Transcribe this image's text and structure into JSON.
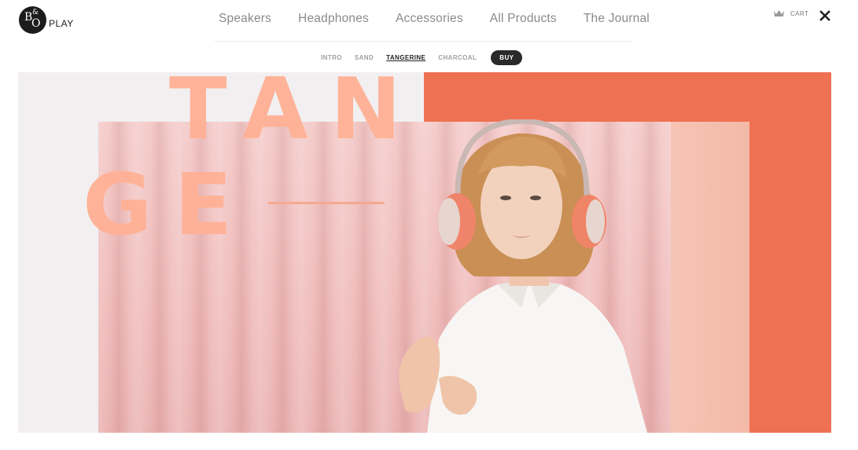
{
  "brand": {
    "logo_letters": "B&O",
    "logo_word": "PLAY"
  },
  "main_nav": {
    "items": [
      {
        "label": "Speakers"
      },
      {
        "label": "Headphones"
      },
      {
        "label": "Accessories"
      },
      {
        "label": "All Products"
      },
      {
        "label": "The Journal"
      }
    ]
  },
  "cart": {
    "label": "CART",
    "icon": "crown-icon"
  },
  "close": {
    "icon": "close-icon"
  },
  "sub_nav": {
    "items": [
      {
        "label": "INTRO",
        "active": false
      },
      {
        "label": "SAND",
        "active": false
      },
      {
        "label": "TANGERINE",
        "active": true
      },
      {
        "label": "CHARCOAL",
        "active": false
      }
    ],
    "buy_label": "BUY"
  },
  "hero": {
    "headline_line1": "TAN",
    "headline_line2": "GE",
    "colors": {
      "accent_orange": "#ef7153",
      "text_peach": "#ffb195",
      "curtain_pink": "#f0bcbb"
    }
  }
}
